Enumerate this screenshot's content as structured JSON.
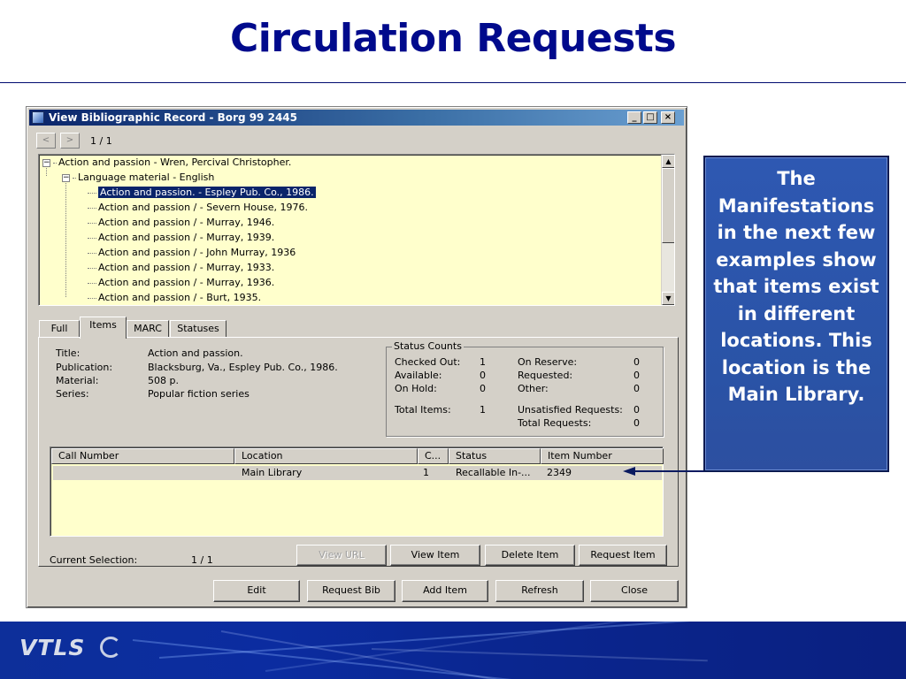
{
  "slide": {
    "title": "Circulation Requests",
    "callout": "The Manifestations in the next few examples show that items exist in different locations. This location is the Main Library."
  },
  "window": {
    "title": "View Bibliographic Record - Borg 99 2445",
    "minimize": "_",
    "maximize": "□",
    "close": "×"
  },
  "nav": {
    "prev": "<",
    "next": ">",
    "counter": "1 / 1"
  },
  "tree": {
    "root": "Action and passion - Wren, Percival Christopher.",
    "child": "Language material - English",
    "items": [
      "Action and passion. - Espley Pub. Co., 1986.",
      "Action and passion / - Severn House, 1976.",
      "Action and passion / - Murray, 1946.",
      "Action and passion / - Murray, 1939.",
      "Action and passion / - John Murray, 1936",
      "Action and passion / - Murray, 1933.",
      "Action and passion / - Murray, 1936.",
      "Action and passion / - Burt, 1935."
    ]
  },
  "tabs": [
    "Full",
    "Items",
    "MARC",
    "Statuses"
  ],
  "details": {
    "title_label": "Title:",
    "title_value": "Action and passion.",
    "publication_label": "Publication:",
    "publication_value": "Blacksburg, Va., Espley Pub. Co., 1986.",
    "material_label": "Material:",
    "material_value": "508 p.",
    "series_label": "Series:",
    "series_value": "Popular fiction series"
  },
  "status_counts": {
    "legend": "Status Counts",
    "checked_out_label": "Checked Out:",
    "checked_out": "1",
    "available_label": "Available:",
    "available": "0",
    "on_hold_label": "On Hold:",
    "on_hold": "0",
    "total_items_label": "Total Items:",
    "total_items": "1",
    "on_reserve_label": "On Reserve:",
    "on_reserve": "0",
    "requested_label": "Requested:",
    "requested": "0",
    "other_label": "Other:",
    "other": "0",
    "unsatisfied_label": "Unsatisfied Requests:",
    "unsatisfied": "0",
    "total_requests_label": "Total Requests:",
    "total_requests": "0"
  },
  "grid": {
    "columns": [
      "Call Number",
      "Location",
      "C...",
      "Status",
      "Item Number"
    ],
    "rows": [
      {
        "call_number": "",
        "location": "Main Library",
        "copy": "1",
        "status": "Recallable In-...",
        "item_number": "2349"
      }
    ]
  },
  "actions": {
    "current_selection_label": "Current Selection:",
    "current_selection_value": "1 / 1",
    "view_url": "View URL",
    "view_item": "View Item",
    "delete_item": "Delete Item",
    "request_item": "Request Item"
  },
  "bottom_buttons": [
    "Edit",
    "Request Bib",
    "Add Item",
    "Refresh",
    "Close"
  ],
  "footer": {
    "logo": "VTLS"
  },
  "colors": {
    "title": "#000a8c",
    "callout_bg": "#2e58b2",
    "selection": "#0a246a",
    "list_bg": "#ffffcc"
  }
}
